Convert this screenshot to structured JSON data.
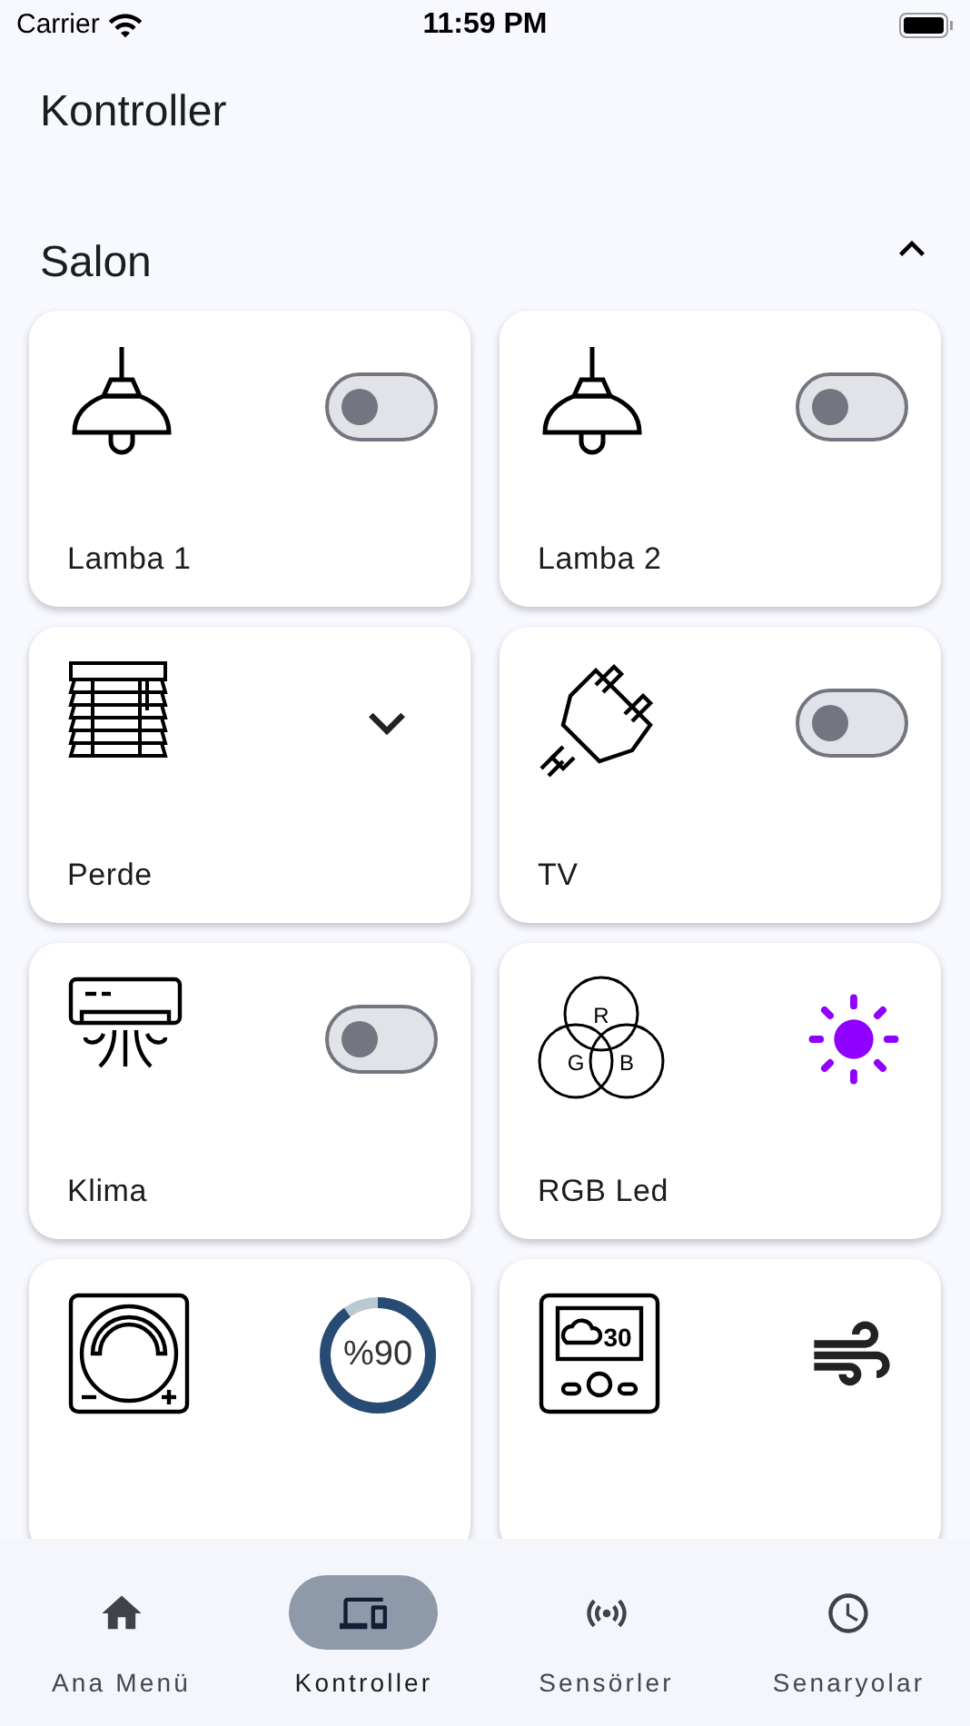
{
  "status_bar": {
    "carrier": "Carrier",
    "time": "11:59 PM"
  },
  "page_title": "Kontroller",
  "room": {
    "name": "Salon",
    "expanded": true,
    "devices": [
      {
        "kind": "lamp",
        "label": "Lamba 1",
        "on": false
      },
      {
        "kind": "lamp",
        "label": "Lamba 2",
        "on": false
      },
      {
        "kind": "blinds",
        "label": "Perde"
      },
      {
        "kind": "plug",
        "label": "TV",
        "on": false
      },
      {
        "kind": "ac",
        "label": "Klima",
        "on": false
      },
      {
        "kind": "rgb",
        "label": "RGB Led",
        "color": "#8f00ff",
        "channels": [
          "R",
          "G",
          "B"
        ]
      },
      {
        "kind": "dimmer",
        "level": 0.9,
        "reading": "%90"
      },
      {
        "kind": "thermostat",
        "display": "30"
      }
    ]
  },
  "nav": [
    {
      "kind": "home",
      "label": "Ana Menü",
      "selected": false
    },
    {
      "kind": "devices",
      "label": "Kontroller",
      "selected": true
    },
    {
      "kind": "sensors",
      "label": "Sensörler",
      "selected": false
    },
    {
      "kind": "clock",
      "label": "Senaryolar",
      "selected": false
    }
  ]
}
